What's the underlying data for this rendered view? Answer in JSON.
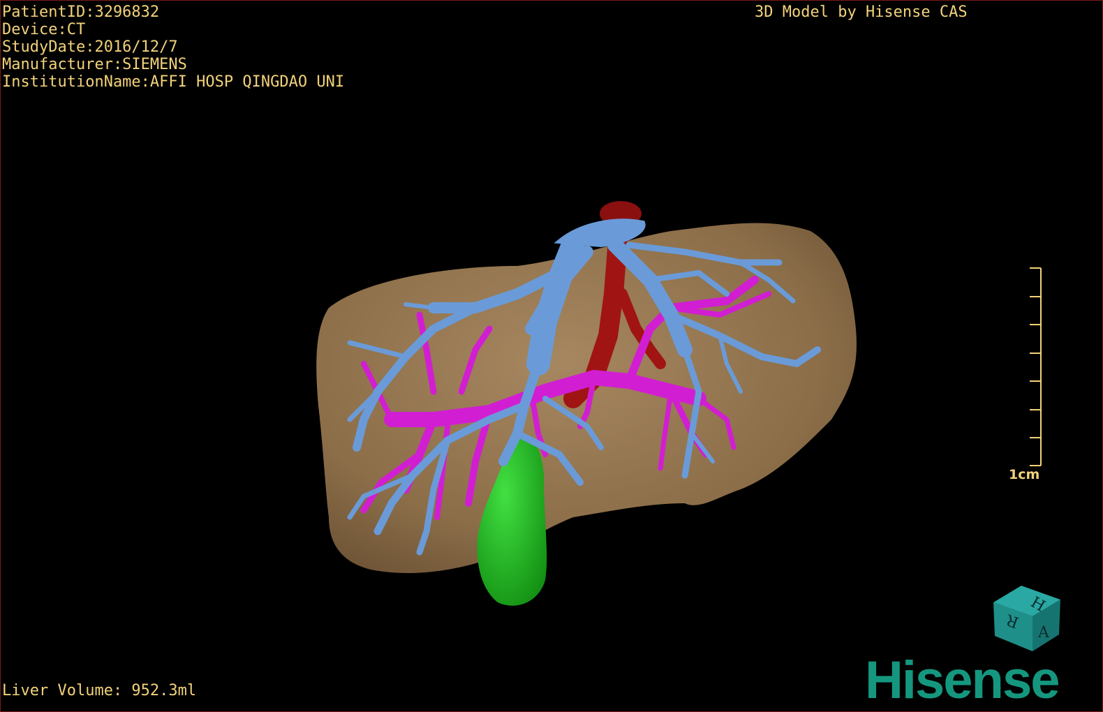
{
  "overlay": {
    "patient_id": "PatientID:3296832",
    "device": "Device:CT",
    "study_date": "StudyDate:2016/12/7",
    "manufacturer": "Manufacturer:SIEMENS",
    "institution": "InstitutionName:AFFI HOSP QINGDAO UNI",
    "credit": "3D Model by Hisense CAS",
    "liver_volume": "Liver Volume: 952.3ml"
  },
  "scale_bar": {
    "label": "1cm",
    "ticks": 8
  },
  "orientation_cube": {
    "faces": [
      "H",
      "R",
      "A"
    ],
    "color": "#1f8f8a"
  },
  "brand": {
    "logo_text": "Hisense",
    "color": "#15977f"
  },
  "colors": {
    "overlay_text": "#f2d27a",
    "liver": "#8b6d48",
    "hepatic_vein": "#6a9bd8",
    "portal_vein": "#d21ed2",
    "artery": "#a01414",
    "gallbladder": "#1fb81f"
  }
}
